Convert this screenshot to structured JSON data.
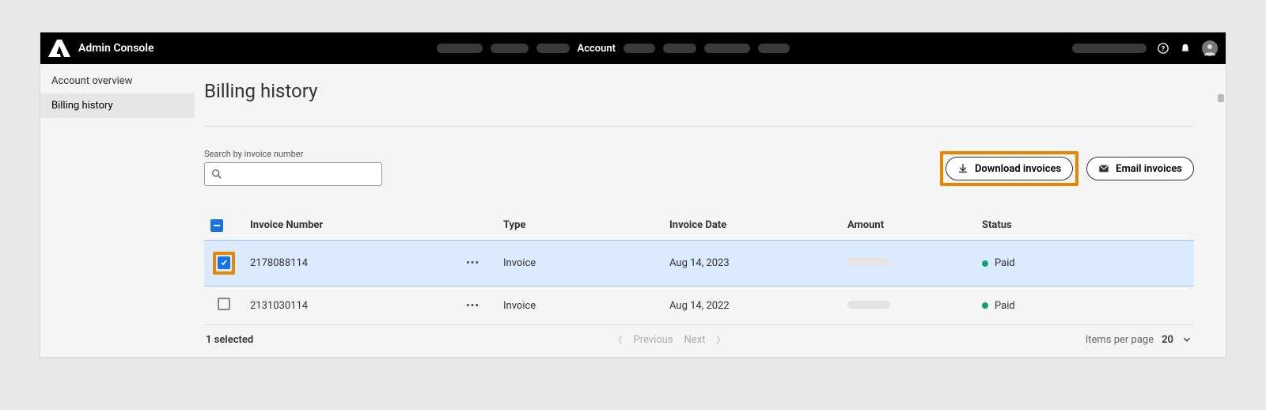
{
  "brand": "Admin Console",
  "nav": {
    "active_label": "Account"
  },
  "sidebar": {
    "items": [
      {
        "label": "Account overview"
      },
      {
        "label": "Billing history"
      }
    ],
    "active_index": 1
  },
  "page": {
    "title": "Billing history"
  },
  "search": {
    "label": "Search by invoice number",
    "value": ""
  },
  "buttons": {
    "download": "Download invoices",
    "email": "Email invoices"
  },
  "table": {
    "headers": {
      "invoice_number": "Invoice Number",
      "type": "Type",
      "invoice_date": "Invoice Date",
      "amount": "Amount",
      "status": "Status"
    },
    "rows": [
      {
        "selected": true,
        "invoice_number": "2178088114",
        "type": "Invoice",
        "date": "Aug 14, 2023",
        "status": "Paid"
      },
      {
        "selected": false,
        "invoice_number": "2131030114",
        "type": "Invoice",
        "date": "Aug 14, 2022",
        "status": "Paid"
      }
    ]
  },
  "footer": {
    "selected_text": "1 selected",
    "previous": "Previous",
    "next": "Next",
    "items_per_page_label": "Items per page",
    "items_per_page_value": "20"
  }
}
